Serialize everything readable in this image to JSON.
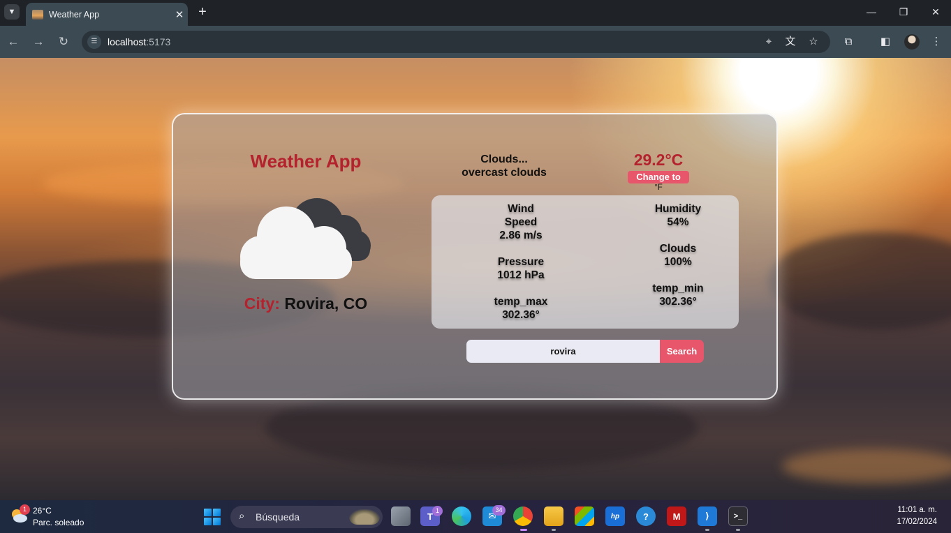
{
  "browser": {
    "tab_title": "Weather App",
    "new_tab": "+",
    "url_host": "localhost",
    "url_port": ":5173"
  },
  "app": {
    "title": "Weather App",
    "city_label": "City:",
    "city_value": "Rovira, CO",
    "condition_main": "Clouds...",
    "condition_desc": "overcast clouds",
    "temperature": "29.2°C",
    "unit_button": "Change to",
    "unit_button_suffix": "°F",
    "weather_icon": "cloud-icon",
    "details": {
      "wind_label_1": "Wind",
      "wind_label_2": "Speed",
      "wind_value": "2.86 m/s",
      "humidity_label": "Humidity",
      "humidity_value": "54%",
      "pressure_label": "Pressure",
      "pressure_value": "1012 hPa",
      "clouds_label": "Clouds",
      "clouds_value": "100%",
      "temp_max_label": "temp_max",
      "temp_max_value": "302.36°",
      "temp_min_label": "temp_min",
      "temp_min_value": "302.36°"
    },
    "search": {
      "value": "rovira",
      "button": "Search"
    },
    "colors": {
      "accent": "#b4222e",
      "button": "#e8566c"
    }
  },
  "taskbar": {
    "weather_temp": "26°C",
    "weather_cond": "Parc. soleado",
    "weather_badge": "1",
    "search_placeholder": "Búsqueda",
    "teams_badge": "1",
    "mail_badge": "34",
    "time": "11:01 a. m.",
    "date": "17/02/2024"
  }
}
